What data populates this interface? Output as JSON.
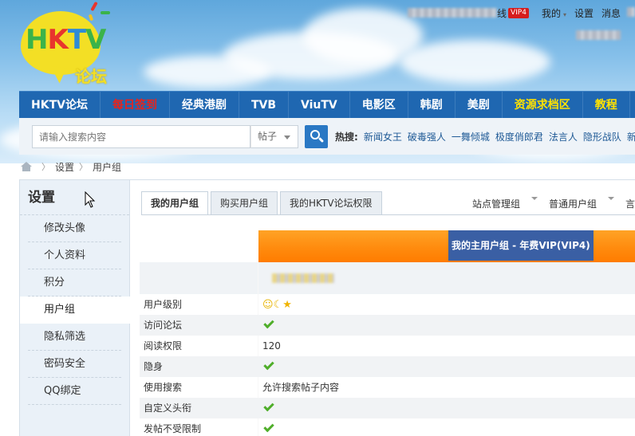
{
  "logo": {
    "h": "H",
    "k": "K",
    "t": "T",
    "v": "V",
    "sub": "论坛"
  },
  "userbar": {
    "vip_suffix": "线",
    "vip_badge": "VIP4",
    "mine": "我的",
    "settings": "设置",
    "messages": "消息"
  },
  "nav": {
    "items": [
      {
        "label": "HKTV论坛",
        "color": "white"
      },
      {
        "label": "每日签到",
        "color": "red"
      },
      {
        "label": "经典港剧",
        "color": "white"
      },
      {
        "label": "TVB",
        "color": "white"
      },
      {
        "label": "ViuTV",
        "color": "white"
      },
      {
        "label": "电影区",
        "color": "white"
      },
      {
        "label": "韩剧",
        "color": "white"
      },
      {
        "label": "美剧",
        "color": "white"
      },
      {
        "label": "资源求档区",
        "color": "yellow"
      },
      {
        "label": "教程",
        "color": "yellow"
      }
    ]
  },
  "search": {
    "placeholder": "请输入搜索内容",
    "type": "帖子",
    "hot_label": "热搜:",
    "hot": [
      "新闻女王",
      "破毒强人",
      "一舞倾城",
      "极度俏郎君",
      "法言人",
      "隐形战队",
      "新"
    ]
  },
  "breadcrumb": {
    "items": [
      "设置",
      "用户组"
    ]
  },
  "side": {
    "title": "设置",
    "items": [
      "修改头像",
      "个人资料",
      "积分",
      "用户组",
      "隐私筛选",
      "密码安全",
      "QQ绑定"
    ],
    "active": 3
  },
  "tabs": [
    "我的用户组",
    "购买用户组",
    "我的HKTV论坛权限"
  ],
  "group_links": [
    "站点管理组",
    "普通用户组",
    "言"
  ],
  "banner": {
    "label": "我的主用户组 - 年费VIP(VIP4)"
  },
  "perms": [
    {
      "key": "用户级别",
      "value": "",
      "type": "level"
    },
    {
      "key": "访问论坛",
      "value": "",
      "type": "check"
    },
    {
      "key": "阅读权限",
      "value": "120",
      "type": "text"
    },
    {
      "key": "隐身",
      "value": "",
      "type": "check"
    },
    {
      "key": "使用搜索",
      "value": "允许搜索帖子内容",
      "type": "text"
    },
    {
      "key": "自定义头衔",
      "value": "",
      "type": "check"
    },
    {
      "key": "发帖不受限制",
      "value": "",
      "type": "check"
    }
  ],
  "colors": {
    "nav": "#1f67b1",
    "banner": "#ff8b0e",
    "banner_label": "#3a5fa4",
    "check": "#4fae2a"
  }
}
